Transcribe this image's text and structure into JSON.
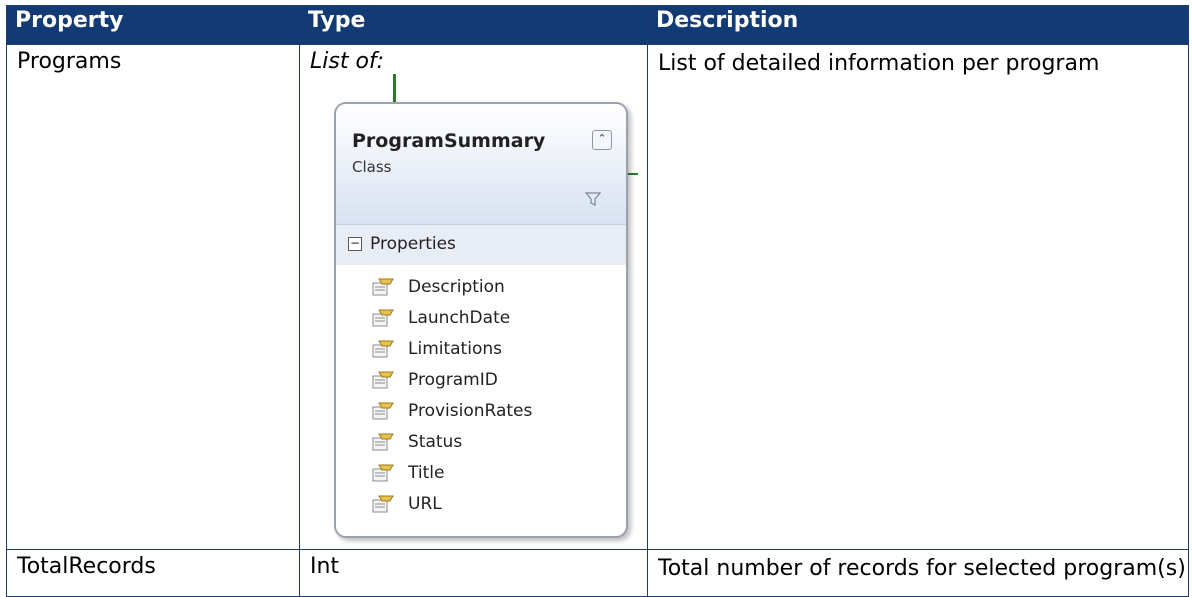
{
  "table": {
    "headers": [
      "Property",
      "Type",
      "Description"
    ],
    "rows": [
      {
        "property": "Programs",
        "type_label": "List of:",
        "description": "List of detailed information per program"
      },
      {
        "property": "TotalRecords",
        "type_label": "Int",
        "description": "Total number of records for selected program(s)"
      }
    ]
  },
  "diagram": {
    "class_name": "ProgramSummary",
    "stereotype": "Class",
    "collapse_icon": "double-chevron-up-icon",
    "filter_icon": "filter-icon",
    "section_label": "Properties",
    "members": [
      "Description",
      "LaunchDate",
      "Limitations",
      "ProgramID",
      "ProvisionRates",
      "Status",
      "Title",
      "URL"
    ],
    "member_icon": "property-icon"
  },
  "colors": {
    "header_bg": "#123a74",
    "header_text": "#ffffff",
    "border": "#1f3a6e",
    "connector": "#2a7a2a"
  }
}
